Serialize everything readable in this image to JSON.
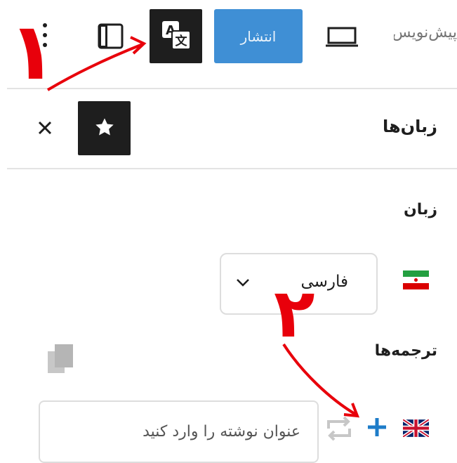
{
  "toolbar": {
    "draft_label": "پیش‌نویس",
    "publish_label": "انتشار",
    "icons": [
      "more-vertical-icon",
      "sidebar-toggle-icon",
      "translate-icon",
      "desktop-preview-icon"
    ]
  },
  "panel": {
    "title": "زبان‌ها",
    "language_label": "زبان",
    "language_value": "فارسی",
    "translations_label": "ترجمه‌ها",
    "title_placeholder": "عنوان نوشته را وارد کنید"
  },
  "annotations": {
    "step1": "۱",
    "step2": "۲"
  },
  "colors": {
    "accent": "#3f8fd5",
    "dark_button": "#1e1e1e",
    "annotation_red": "#e8000b",
    "plus_blue": "#1e7cc8"
  }
}
